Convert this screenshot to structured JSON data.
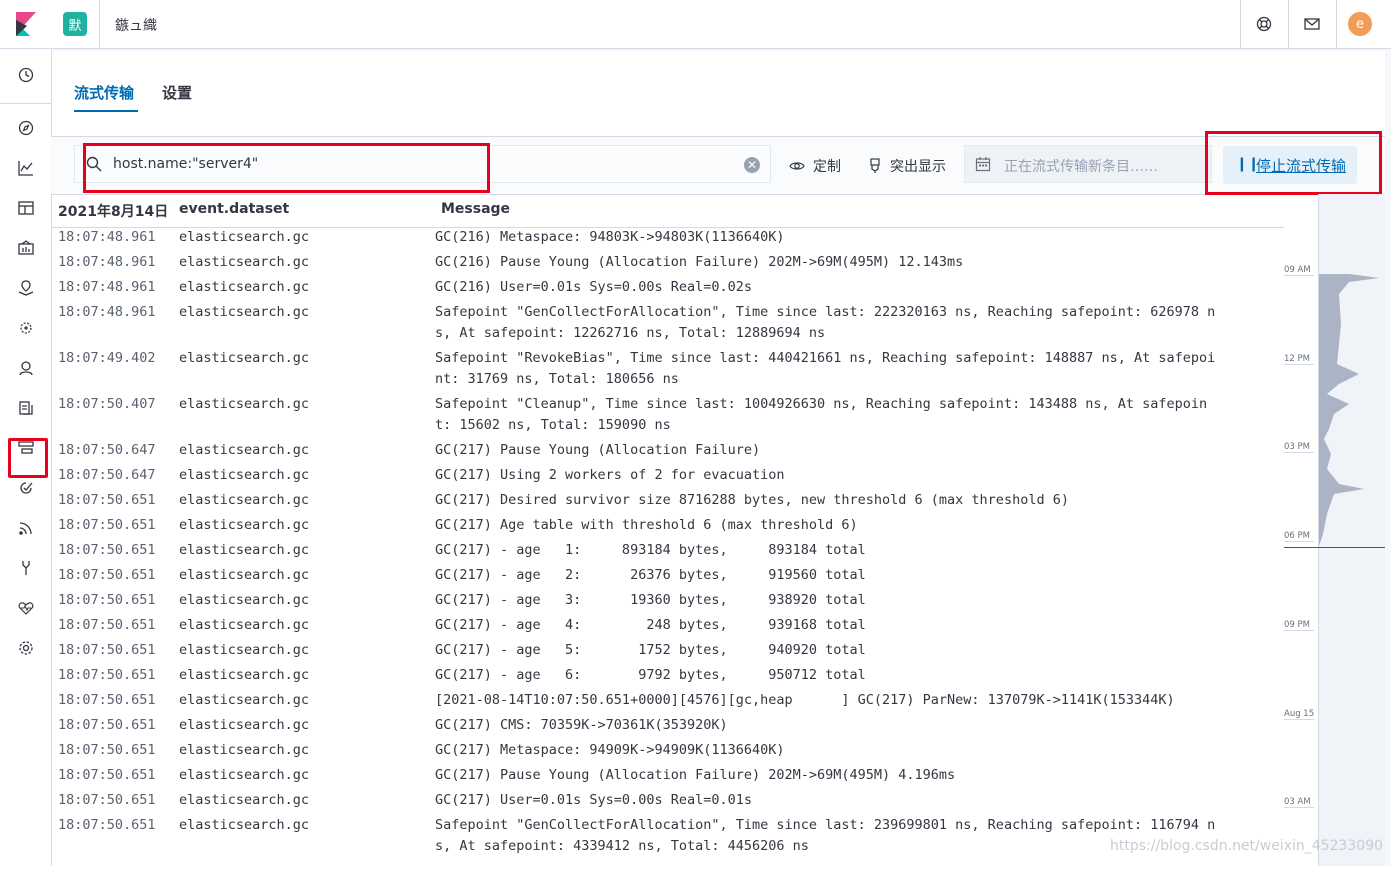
{
  "header": {
    "space_badge": "默",
    "app_title": "鏃ュ織",
    "avatar_letter": "e"
  },
  "tabs": [
    {
      "label": "流式传输",
      "active": true
    },
    {
      "label": "设置",
      "active": false
    }
  ],
  "toolbar": {
    "search_value": "host.name:\"server4\"",
    "customize_label": "定制",
    "highlight_label": "突出显示",
    "streaming_placeholder": "正在流式传输新条目……",
    "stop_label": "停止流式传输"
  },
  "table": {
    "columns": [
      "2021年8月14日",
      "event.dataset",
      "Message"
    ],
    "rows": [
      {
        "time": "18:07:48.961",
        "dataset": "elasticsearch.gc",
        "message": "GC(216) Metaspace: 94803K->94803K(1136640K)"
      },
      {
        "time": "18:07:48.961",
        "dataset": "elasticsearch.gc",
        "message": "GC(216) Pause Young (Allocation Failure) 202M->69M(495M) 12.143ms"
      },
      {
        "time": "18:07:48.961",
        "dataset": "elasticsearch.gc",
        "message": "GC(216) User=0.01s Sys=0.00s Real=0.02s"
      },
      {
        "time": "18:07:48.961",
        "dataset": "elasticsearch.gc",
        "message": "Safepoint \"GenCollectForAllocation\", Time since last: 222320163 ns, Reaching safepoint: 626978 ns, At safepoint: 12262716 ns, Total: 12889694 ns"
      },
      {
        "time": "18:07:49.402",
        "dataset": "elasticsearch.gc",
        "message": "Safepoint \"RevokeBias\", Time since last: 440421661 ns, Reaching safepoint: 148887 ns, At safepoint: 31769 ns, Total: 180656 ns"
      },
      {
        "time": "18:07:50.407",
        "dataset": "elasticsearch.gc",
        "message": "Safepoint \"Cleanup\", Time since last: 1004926630 ns, Reaching safepoint: 143488 ns, At safepoint: 15602 ns, Total: 159090 ns"
      },
      {
        "time": "18:07:50.647",
        "dataset": "elasticsearch.gc",
        "message": "GC(217) Pause Young (Allocation Failure)"
      },
      {
        "time": "18:07:50.647",
        "dataset": "elasticsearch.gc",
        "message": "GC(217) Using 2 workers of 2 for evacuation"
      },
      {
        "time": "18:07:50.651",
        "dataset": "elasticsearch.gc",
        "message": "GC(217) Desired survivor size 8716288 bytes, new threshold 6 (max threshold 6)"
      },
      {
        "time": "18:07:50.651",
        "dataset": "elasticsearch.gc",
        "message": "GC(217) Age table with threshold 6 (max threshold 6)"
      },
      {
        "time": "18:07:50.651",
        "dataset": "elasticsearch.gc",
        "message": "GC(217) - age   1:     893184 bytes,     893184 total"
      },
      {
        "time": "18:07:50.651",
        "dataset": "elasticsearch.gc",
        "message": "GC(217) - age   2:      26376 bytes,     919560 total"
      },
      {
        "time": "18:07:50.651",
        "dataset": "elasticsearch.gc",
        "message": "GC(217) - age   3:      19360 bytes,     938920 total"
      },
      {
        "time": "18:07:50.651",
        "dataset": "elasticsearch.gc",
        "message": "GC(217) - age   4:        248 bytes,     939168 total"
      },
      {
        "time": "18:07:50.651",
        "dataset": "elasticsearch.gc",
        "message": "GC(217) - age   5:       1752 bytes,     940920 total"
      },
      {
        "time": "18:07:50.651",
        "dataset": "elasticsearch.gc",
        "message": "GC(217) - age   6:       9792 bytes,     950712 total"
      },
      {
        "time": "18:07:50.651",
        "dataset": "elasticsearch.gc",
        "message": "[2021-08-14T10:07:50.651+0000][4576][gc,heap      ] GC(217) ParNew: 137079K->1141K(153344K)"
      },
      {
        "time": "18:07:50.651",
        "dataset": "elasticsearch.gc",
        "message": "GC(217) CMS: 70359K->70361K(353920K)"
      },
      {
        "time": "18:07:50.651",
        "dataset": "elasticsearch.gc",
        "message": "GC(217) Metaspace: 94909K->94909K(1136640K)"
      },
      {
        "time": "18:07:50.651",
        "dataset": "elasticsearch.gc",
        "message": "GC(217) Pause Young (Allocation Failure) 202M->69M(495M) 4.196ms"
      },
      {
        "time": "18:07:50.651",
        "dataset": "elasticsearch.gc",
        "message": "GC(217) User=0.01s Sys=0.00s Real=0.01s"
      },
      {
        "time": "18:07:50.651",
        "dataset": "elasticsearch.gc",
        "message": "Safepoint \"GenCollectForAllocation\", Time since last: 239699801 ns, Reaching safepoint: 116794 ns, At safepoint: 4339412 ns, Total: 4456206 ns"
      }
    ]
  },
  "minimap": {
    "labels": [
      "09 AM",
      "12 PM",
      "03 PM",
      "06 PM",
      "09 PM",
      "Aug 15",
      "03 AM"
    ]
  },
  "watermark": "https://blog.csdn.net/weixin_45233090",
  "colors": {
    "accent": "#006bb4",
    "highlight_border": "#e8001c",
    "space_badge": "#20b2a0",
    "avatar": "#f19d57"
  }
}
